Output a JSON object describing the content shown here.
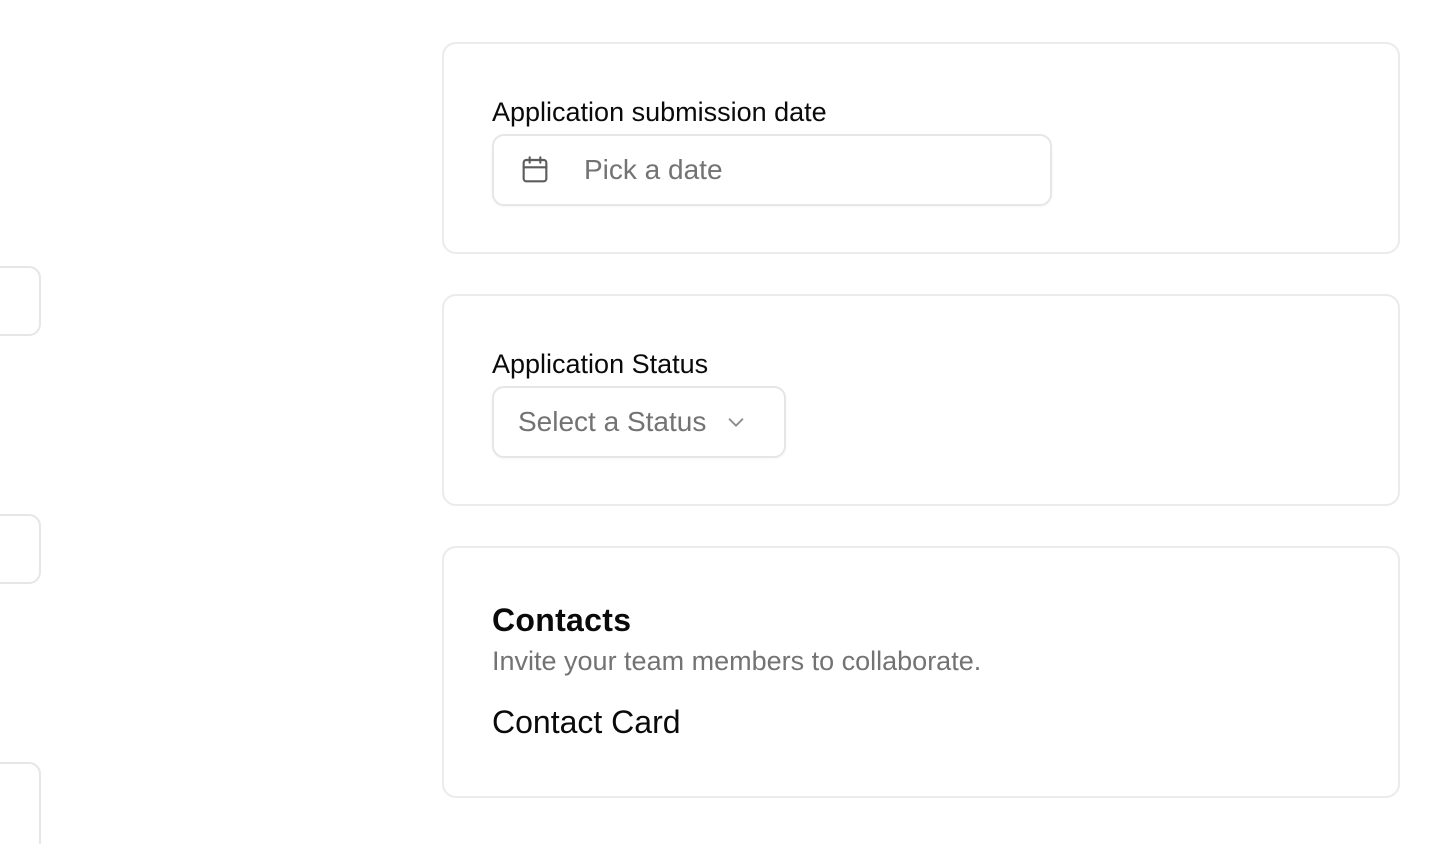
{
  "date_field": {
    "label": "Application submission date",
    "placeholder": "Pick a date",
    "icon": "calendar-icon"
  },
  "status_field": {
    "label": "Application Status",
    "placeholder": "Select a Status",
    "icon": "chevron-down-icon"
  },
  "contacts": {
    "title": "Contacts",
    "description": "Invite your team members to collaborate.",
    "card_label": "Contact Card"
  },
  "colors": {
    "border": "#ebebed",
    "muted_text": "#737373",
    "text": "#0a0a0a",
    "background": "#ffffff"
  }
}
